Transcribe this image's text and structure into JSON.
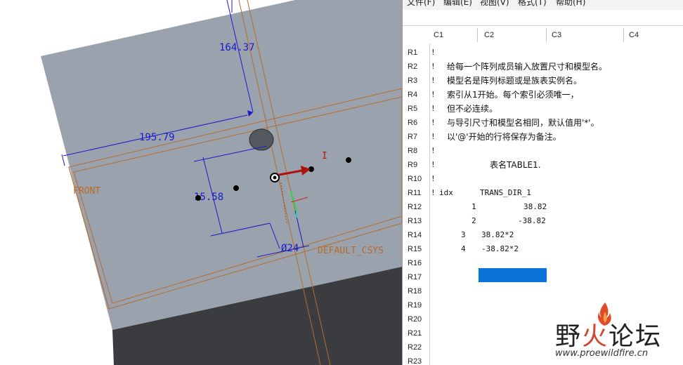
{
  "viewport": {
    "dimensions": {
      "d1": "164.37",
      "d2": "195.79",
      "d3": "15.58",
      "d4": "Ø24"
    },
    "labels": {
      "front": "FRONT",
      "csys": "DEFAULT_CSYS",
      "cursor_mark": "I"
    },
    "colors": {
      "surface": "#9aa3ad",
      "dark_face": "#3a3c40",
      "datum": "#b86a2a",
      "dimension": "#1a1acc",
      "arrow": "#b01010"
    }
  },
  "editor": {
    "menu": [
      "文件(F)",
      "编辑(E)",
      "视图(V)",
      "格式(T)",
      "帮助(H)"
    ],
    "columns": [
      "C1",
      "C2",
      "C3",
      "C4"
    ],
    "rows": [
      "R1",
      "R2",
      "R3",
      "R4",
      "R5",
      "R6",
      "R7",
      "R8",
      "R9",
      "R10",
      "R11",
      "R12",
      "R13",
      "R14",
      "R15",
      "R16",
      "R17",
      "R18",
      "R19",
      "R20",
      "R21",
      "R22",
      "R23"
    ],
    "comment_mark": "!",
    "comments": [
      "",
      "给每一个阵列成员输入放置尺寸和模型名。",
      "模型名是阵列标题或是族表实例名。",
      "索引从1开始。每个索引必须唯一，",
      "但不必连续。",
      "与导引尺寸和模型名相同，默认值用'*'。",
      "以'@'开始的行将保存为备注。",
      "",
      "表名TABLE1.",
      ""
    ],
    "table_header": {
      "idx": "idx",
      "param": "TRANS_DIR_1"
    },
    "table_rows": [
      {
        "idx": "1",
        "value": "38.82"
      },
      {
        "idx": "2",
        "value": "-38.82"
      },
      {
        "idx": "3",
        "value": "38.82*2"
      },
      {
        "idx": "4",
        "value": "-38.82*2"
      }
    ],
    "selection_color": "#0a74d6"
  },
  "watermark": {
    "site_name": "野火论坛",
    "url": "www.proewildfire.cn"
  }
}
